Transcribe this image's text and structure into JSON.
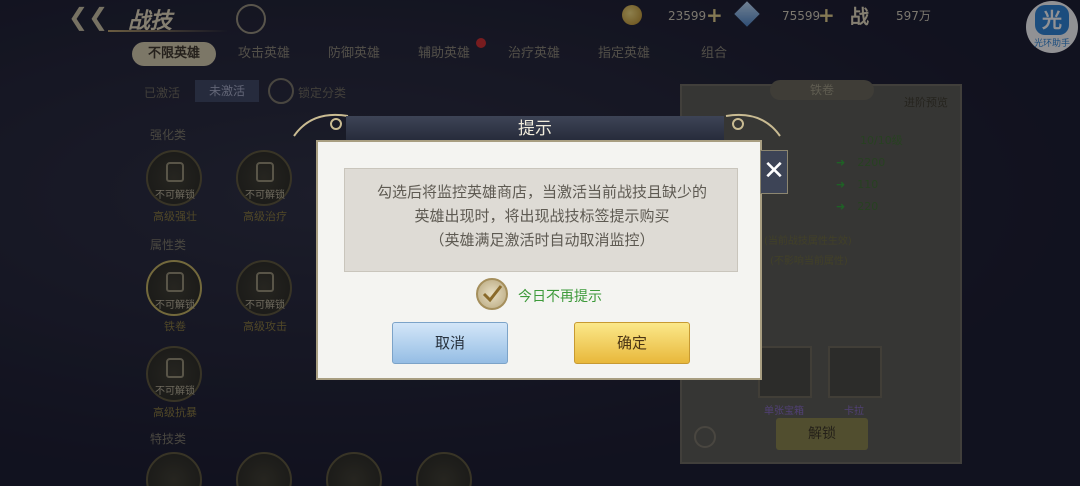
{
  "topbar": {
    "back_icon": "back-arrow-icon",
    "title": "战技",
    "help_text": "",
    "gold": "23599",
    "gems": "75599",
    "power_label": "战",
    "power_value": "597万"
  },
  "logo": {
    "mark": "光",
    "text": "光环助手"
  },
  "tabs": [
    {
      "label": "不限英雄",
      "active": true
    },
    {
      "label": "攻击英雄",
      "active": false
    },
    {
      "label": "防御英雄",
      "active": false
    },
    {
      "label": "辅助英雄",
      "active": false
    },
    {
      "label": "治疗英雄",
      "active": false
    },
    {
      "label": "指定英雄",
      "active": false
    },
    {
      "label": "组合",
      "active": false
    }
  ],
  "filter": {
    "label": "已激活",
    "button": "未激活",
    "lock_label": "锁定分类"
  },
  "sections": {
    "enhance": "强化类",
    "attribute": "属性类",
    "special": "特技类"
  },
  "skills": [
    {
      "lock_text": "不可解锁",
      "name": "高级强壮"
    },
    {
      "lock_text": "不可解锁",
      "name": "高级治疗"
    },
    {
      "lock_text": "不可解锁",
      "name": "铁卷"
    },
    {
      "lock_text": "不可解锁",
      "name": "高级攻击"
    },
    {
      "lock_text": "不可解锁",
      "name": "高级抗暴"
    }
  ],
  "right_panel": {
    "tab": "铁卷",
    "preview_btn": "进阶预览",
    "level": "10/10级",
    "stats": [
      "2200",
      "110",
      "220"
    ],
    "note1": "(当前战技属性生效)",
    "note2": "(不影响当前属性)",
    "card1_label": "单张宝箱",
    "card2_label": "卡拉",
    "unlock_btn": "解锁"
  },
  "dialog": {
    "title": "提示",
    "message_line1": "勾选后将监控英雄商店，当激活当前战技且缺少的",
    "message_line2": "英雄出现时，将出现战技标签提示购买",
    "message_line3": "（英雄满足激活时自动取消监控）",
    "checkbox_label": "今日不再提示",
    "cancel": "取消",
    "confirm": "确定",
    "close": "✕"
  }
}
